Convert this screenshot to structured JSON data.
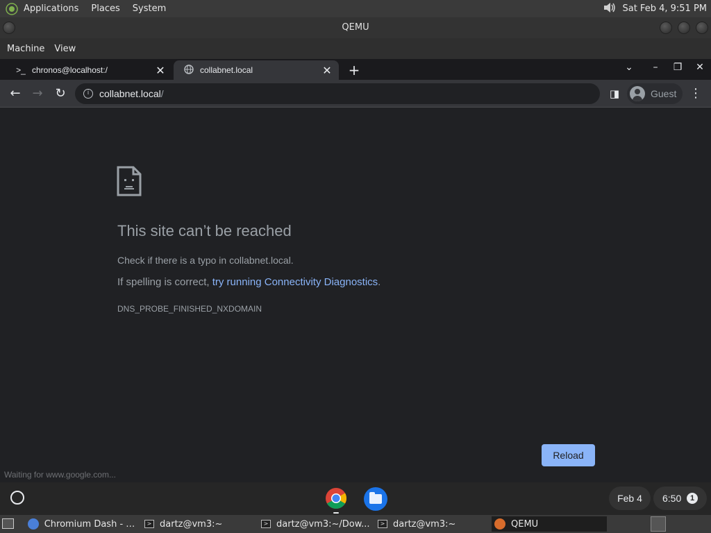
{
  "top_panel": {
    "menus": [
      "Applications",
      "Places",
      "System"
    ],
    "clock": "Sat Feb  4,  9:51 PM",
    "volume_icon": "speaker-icon"
  },
  "qemu": {
    "title": "QEMU",
    "menus": [
      "Machine",
      "View"
    ]
  },
  "browser": {
    "tabs": [
      {
        "label": "chronos@localhost:/",
        "icon": "terminal-icon",
        "active": false
      },
      {
        "label": "collabnet.local",
        "icon": "globe-icon",
        "active": true
      }
    ],
    "omnibox": {
      "host": "collabnet.local",
      "path": "/"
    },
    "profile": "Guest"
  },
  "error_page": {
    "title": "This site can’t be reached",
    "line1": "Check if there is a typo in collabnet.local.",
    "line2_prefix": "If spelling is correct, ",
    "line2_link": "try running Connectivity Diagnostics",
    "line2_suffix": ".",
    "code": "DNS_PROBE_FINISHED_NXDOMAIN",
    "reload_label": "Reload"
  },
  "status_bar": "Waiting for www.google.com...",
  "shelf": {
    "date": "Feb 4",
    "time": "6:50",
    "notification_count": "1"
  },
  "taskbar": {
    "tasks": [
      {
        "label": "Chromium Dash - C...",
        "icon": "chromium-icon"
      },
      {
        "label": "dartz@vm3:~",
        "icon": "terminal-icon"
      },
      {
        "label": "dartz@vm3:~/Dow...",
        "icon": "terminal-icon"
      },
      {
        "label": "dartz@vm3:~",
        "icon": "terminal-icon"
      },
      {
        "label": "QEMU",
        "icon": "qemu-icon"
      }
    ]
  },
  "colors": {
    "link": "#8ab4f8",
    "reload_button": "#8ab4f8",
    "page_background": "#202124"
  }
}
